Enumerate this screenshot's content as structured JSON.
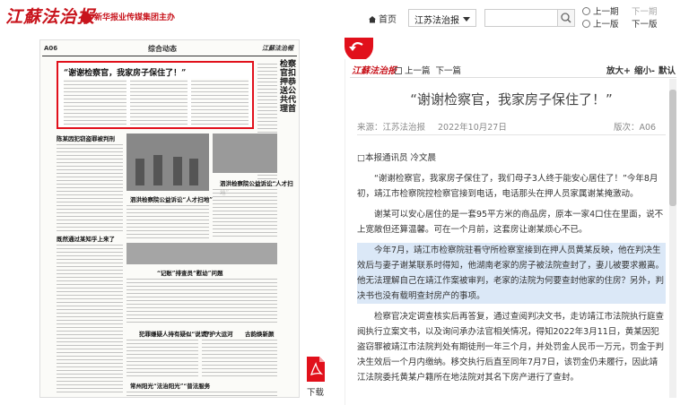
{
  "header": {
    "logo": "江蘇法治报",
    "sublogo": "新华报业传媒集团主办",
    "home_label": "首页",
    "paper_select": "江苏法治报",
    "search_placeholder": "",
    "prev_period": "上一期",
    "next_period": "下一期",
    "prev_page": "上一版",
    "next_page": "下一版"
  },
  "newspaper_page": {
    "page_number": "A06",
    "section": "综合动态",
    "brand": "江蘇法治報",
    "headline": "“谢谢检察官，我家房子保住了！”",
    "vertical_headline": "检察官扣押恭送公共代理首",
    "story2": "陈某因犯窃盗罪被判刑",
    "story3": "既然通过某知乎上来了",
    "story4": "泗洪检察院公益诉讼“人才扫地”",
    "story5": "“记账”排查员“慰幼”问题",
    "story6": "犯罪嫌疑人持有疑似“说谎”",
    "story7": "常州阳光“法治阳光”“普法服务",
    "story8": "守护大运河",
    "story9": "古韵焕新颜"
  },
  "download_label": "下载",
  "panel": {
    "logo": "江蘇法治报",
    "prev_article": "上一篇",
    "next_article": "下一篇",
    "zoom_in": "放大+",
    "zoom_out": "缩小-",
    "reset": "默认"
  },
  "article": {
    "title": "“谢谢检察官，我家房子保住了！”",
    "source": "来源：江苏法治报",
    "date": "2022年10月27日",
    "edition": "版次：A06",
    "author": "□本报通讯员 冷文晨",
    "paragraphs": [
      "“谢谢检察官，我家房子保住了，我们母子3人终于能安心居住了！”今年8月初，靖江市检察院控检察官接到电话，电话那头在押人员家属谢某掩激动。",
      "谢某可以安心居住的是一套95平方米的商品房，原本一家4口住在里面，说不上宽敞但还算温馨。可在一个月前，这套房让谢某烦心不已。",
      "今年7月，靖江市检察院驻看守所检察室接到在押人员黄某反映，他在判决生效后与妻子谢某联系时得知，他湖南老家的房子被法院查封了，妻儿被要求搬离。他无法理解自己在靖江作案被审判，老家的法院为何要查封他家的住房？另外，判决书也没有载明查封房产的事项。",
      "检察官决定调查核实后再答复，通过查阅判决文书，走访靖江市法院执行庭查阅执行立案文书，以及询问承办法官相关情况，得知2022年3月11日，黄某因犯盗窃罪被靖江市法院判处有期徒刑一年三个月，并处罚金人民币一万元，罚金于判决生效后一个月内缴纳。移交执行后直至同年7月7日，该罚金仍未履行，因此靖江法院委托黄某户籍所在地法院对其名下房产进行了查封。"
    ]
  }
}
